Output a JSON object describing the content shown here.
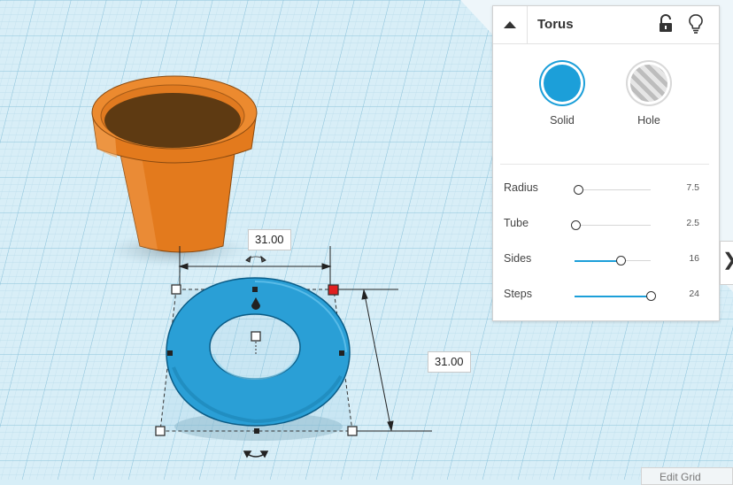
{
  "viewport": {
    "dimension_width": "31.00",
    "dimension_depth": "31.00"
  },
  "inspector": {
    "shape_name": "Torus",
    "solid_label": "Solid",
    "hole_label": "Hole",
    "params": [
      {
        "label": "Radius",
        "value": "7.5",
        "fraction": 0.05
      },
      {
        "label": "Tube",
        "value": "2.5",
        "fraction": 0.01
      },
      {
        "label": "Sides",
        "value": "16",
        "fraction": 0.6
      },
      {
        "label": "Steps",
        "value": "24",
        "fraction": 1.0
      }
    ]
  },
  "edit_grid_label": "Edit Grid",
  "side_tab_glyph": "❯",
  "colors": {
    "accent": "#1c9fd9",
    "shape_blue": "#2a9fd6",
    "pot_orange": "#e2781c",
    "pot_soil": "#5e3a12",
    "handle_red": "#e02020",
    "grid_bg": "#d7eef7"
  },
  "icons": {
    "collapse": "triangle-up-icon",
    "lock": "unlock-icon",
    "visibility": "lightbulb-icon"
  }
}
